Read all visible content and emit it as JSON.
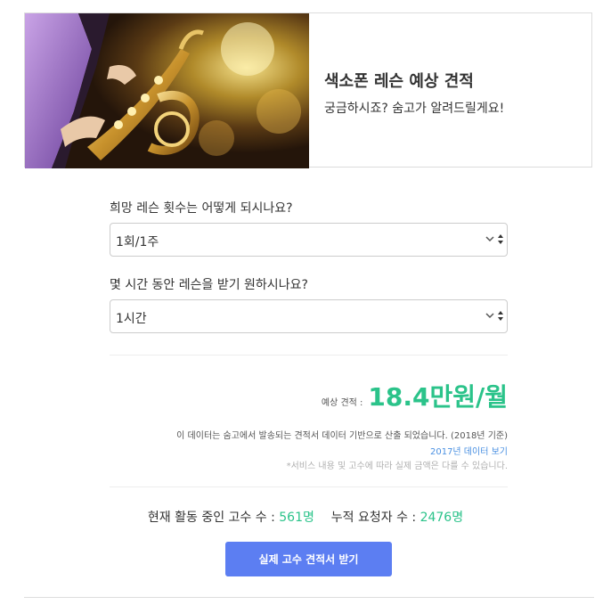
{
  "hero": {
    "title": "색소폰 레슨 예상 견적",
    "subtitle": "궁금하시죠? 숨고가 알려드릴게요!"
  },
  "form": {
    "q1": {
      "label": "희망 레슨 횟수는 어떻게 되시나요?",
      "value": "1회/1주"
    },
    "q2": {
      "label": "몇 시간 동안 레슨을 받기 원하시나요?",
      "value": "1시간"
    }
  },
  "estimate": {
    "label": "예상 견적 :",
    "amount": "18.4만원/월"
  },
  "notes": {
    "source": "이 데이터는 숨고에서 발송되는 견적서 데이터 기반으로 산출 되었습니다. (2018년 기준)",
    "link": "2017년 데이터 보기",
    "disclaimer": "*서비스 내용 및 고수에 따라 실제 금액은 다를 수 있습니다."
  },
  "stats": {
    "active_label": "현재 활동 중인 고수 수 :",
    "active_value": "561명",
    "requests_label": "누적 요청자 수 :",
    "requests_value": "2476명"
  },
  "cta": {
    "label": "실제 고수 견적서 받기"
  },
  "colors": {
    "accent_green": "#2bc38a",
    "button_blue": "#5c7ef2",
    "link_blue": "#4a90e2"
  },
  "icons": {
    "select": "chevron-updown-icon",
    "hero_image": "saxophone-photo"
  }
}
